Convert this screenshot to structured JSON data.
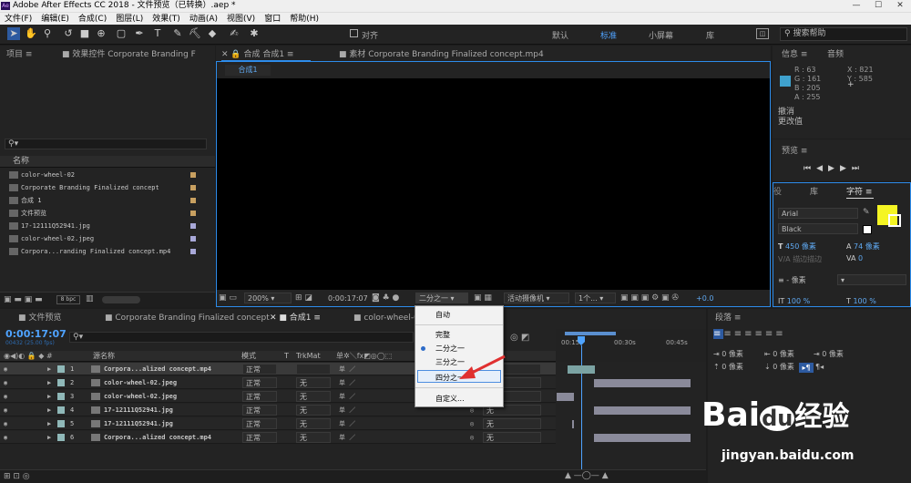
{
  "window": {
    "title": "Adobe After Effects CC 2018 - 文件预览（已转换）.aep *",
    "logo": "Ae",
    "min": "—",
    "max": "☐",
    "close": "✕"
  },
  "menu": [
    "文件(F)",
    "编辑(E)",
    "合成(C)",
    "图层(L)",
    "效果(T)",
    "动画(A)",
    "视图(V)",
    "窗口",
    "帮助(H)"
  ],
  "toolbar": {
    "snap": "对齐",
    "workspaces": [
      "默认",
      "标准",
      "小屏幕",
      "库"
    ],
    "active_ws": "标准",
    "search": "搜索帮助"
  },
  "project": {
    "tab": "项目",
    "effect_tab": "效果控件 Corporate Branding F",
    "name_col": "名称",
    "bpc": "8 bpc",
    "items": [
      {
        "name": "color-wheel-02",
        "color": "#c8a060"
      },
      {
        "name": "Corporate Branding  Finalized concept",
        "color": "#c8a060"
      },
      {
        "name": "合成 1",
        "color": "#c8a060"
      },
      {
        "name": "文件预览",
        "color": "#c8a060"
      },
      {
        "name": "17-12111Q52941.jpg",
        "color": "#a8a8d8"
      },
      {
        "name": "color-wheel-02.jpeg",
        "color": "#a8a8d8"
      },
      {
        "name": "Corpora...randing  Finalized concept.mp4",
        "color": "#a8a8d8"
      }
    ]
  },
  "comp": {
    "tab": "合成 合成1",
    "sub": "合成1",
    "footage_tab": "素材 Corporate Branding  Finalized concept.mp4",
    "zoom": "200%",
    "time": "0:00:17:07",
    "res": "二分之一",
    "camera": "活动摄像机",
    "views": "1个...",
    "exposure": "+0.0"
  },
  "info": {
    "tab": "信息",
    "audio": "音频",
    "r": "R : 63",
    "g": "G : 161",
    "b": "B : 205",
    "a": "A : 255",
    "x": "X : 821",
    "y": "Y : 585",
    "swatch": "#3fa1cd",
    "undo1": "撤消",
    "undo2": "更改值"
  },
  "preview": {
    "tab": "预览"
  },
  "character": {
    "tab": "字符",
    "lib": "库",
    "font": "Arial",
    "style": "Black",
    "size": "450 像素",
    "leading": "74 像素",
    "tracking": "0",
    "unit": "- 像素",
    "stroke": "描边描边",
    "scale_v": "100 %",
    "scale_h": "100 %",
    "fill": "#f5f523"
  },
  "timeline": {
    "tabs": [
      "文件预览",
      "Corporate Branding  Finalized concept",
      "合成1",
      "color-wheel-0"
    ],
    "time": "0:00:17:07",
    "frames": "00432 (25.00 fps)",
    "cols": {
      "name": "源名称",
      "mode": "模式",
      "t": "T",
      "trkmat": "TrkMat"
    },
    "layers": [
      {
        "num": "1",
        "name": "Corpora...alized concept.mp4",
        "mode": "正常",
        "trk": "",
        "color": "#8fb8b8"
      },
      {
        "num": "2",
        "name": "color-wheel-02.jpeg",
        "mode": "正常",
        "trk": "无",
        "color": "#8fb8b8"
      },
      {
        "num": "3",
        "name": "color-wheel-02.jpeg",
        "mode": "正常",
        "trk": "无",
        "color": "#8fb8b8"
      },
      {
        "num": "4",
        "name": "17-12111Q52941.jpg",
        "mode": "正常",
        "trk": "无",
        "color": "#8fb8b8"
      },
      {
        "num": "5",
        "name": "17-12111Q52941.jpg",
        "mode": "正常",
        "trk": "无",
        "color": "#8fb8b8"
      },
      {
        "num": "6",
        "name": "Corpora...alized concept.mp4",
        "mode": "正常",
        "trk": "无",
        "color": "#8fb8b8"
      }
    ],
    "parent": "无",
    "ruler": [
      "00:15s",
      "00:30s",
      "00:45s"
    ]
  },
  "paragraph": {
    "tab": "段落",
    "v1": "0 像素",
    "v2": "0 像素",
    "v3": "0 像素",
    "v4": "0 像素",
    "v5": "0 像素"
  },
  "resmenu": {
    "items": [
      "自动",
      "完整",
      "二分之一",
      "三分之一",
      "四分之一",
      "自定义..."
    ],
    "checked": "二分之一"
  },
  "watermark": {
    "brand": "Bai",
    "paw": "du",
    "cn": "经验",
    "url": "jingyan.baidu.com"
  }
}
